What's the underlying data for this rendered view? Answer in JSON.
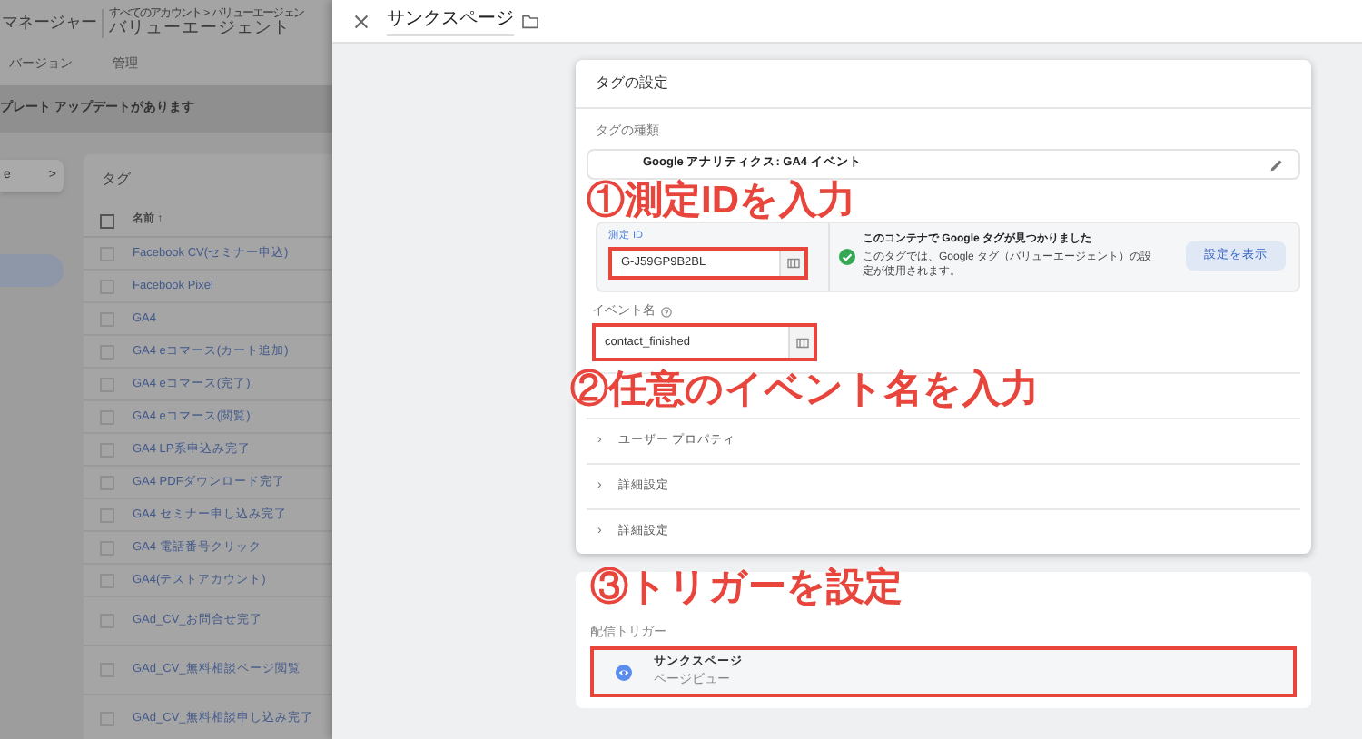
{
  "background_app": {
    "product": "マネージャー",
    "breadcrumb": "すべてのアカウント > バリューエージェン",
    "account": "バリューエージェント",
    "tabs": [
      {
        "label": "バージョン",
        "selected": false
      },
      {
        "label": "管理",
        "selected": false
      }
    ],
    "banner": "プレート アップデートがあります",
    "side_button": {
      "label": "e",
      "chevron": ">"
    },
    "tags_table": {
      "title": "タグ",
      "column": "名前 ↑",
      "checked": false,
      "rows": [
        {
          "name": "Facebook CV(セミナー申込)",
          "checked": false
        },
        {
          "name": "Facebook Pixel",
          "checked": false
        },
        {
          "name": "GA4",
          "checked": false
        },
        {
          "name": "GA4 eコマース(カート追加)",
          "checked": false
        },
        {
          "name": "GA4 eコマース(完了)",
          "checked": false
        },
        {
          "name": "GA4 eコマース(閲覧)",
          "checked": false
        },
        {
          "name": "GA4 LP系申込み完了",
          "checked": false
        },
        {
          "name": "GA4 PDFダウンロード完了",
          "checked": false
        },
        {
          "name": "GA4 セミナー申し込み完了",
          "checked": false
        },
        {
          "name": "GA4 電話番号クリック",
          "checked": false
        },
        {
          "name": "GA4(テストアカウント)",
          "checked": false
        },
        {
          "name": "GAd_CV_お問合せ完了",
          "checked": false
        },
        {
          "name": "GAd_CV_無料相談ページ閲覧",
          "checked": false
        },
        {
          "name": "GAd_CV_無料相談申し込み完了",
          "checked": false
        }
      ]
    }
  },
  "editor": {
    "title": "サンクスページ",
    "tag_config": {
      "heading": "タグの設定",
      "type_label": "タグの種類",
      "type_name": "Google アナリティクス: GA4 イベント",
      "measurement_id": {
        "label": "測定 ID",
        "value": "G-J59GP9B2BL",
        "highlighted": true
      },
      "google_tag_notice": {
        "title": "このコンテナで Google タグが見つかりました",
        "body": "このタグでは、Google タグ（バリューエージェント）の設定が使用されます。",
        "button": "設定を表示"
      },
      "event_name": {
        "label": "イベント名",
        "value": "contact_finished",
        "highlighted": true
      },
      "sections": [
        {
          "chevron": "›",
          "label": "ユーザー プロパティ"
        },
        {
          "chevron": "›",
          "label": "詳細設定"
        },
        {
          "chevron": "›",
          "label": "詳細設定"
        }
      ]
    },
    "triggering": {
      "label": "配信トリガー",
      "trigger": {
        "name": "サンクスページ",
        "type": "ページビュー",
        "highlighted": true
      }
    }
  },
  "annotations": [
    {
      "kind": "id",
      "text": "①測定IDを入力"
    },
    {
      "kind": "event",
      "text": "②任意のイベント名を入力"
    },
    {
      "kind": "trigger",
      "text": "③トリガーを設定"
    }
  ]
}
